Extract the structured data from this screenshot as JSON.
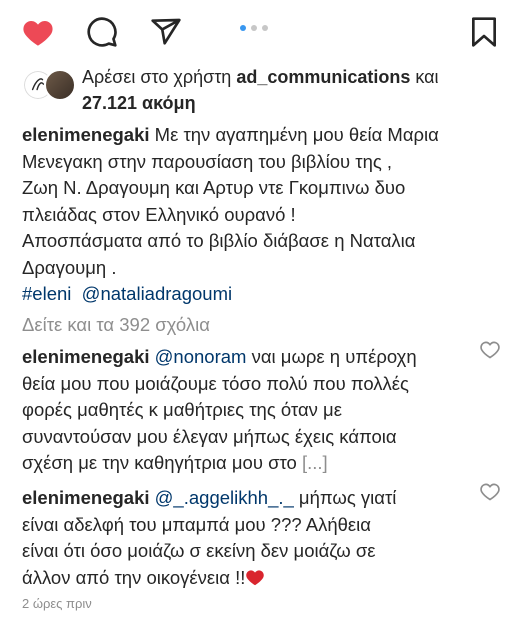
{
  "actions": {
    "like": "heart-filled-icon",
    "comment": "comment-icon",
    "share": "share-icon",
    "save": "bookmark-icon",
    "like_color": "#ed4956"
  },
  "carousel": {
    "count": 3,
    "active": 0
  },
  "likes": {
    "prefix": "Αρέσει στο χρήστη ",
    "user": "ad_communications",
    "middle": " και ",
    "count": "27.121 ακόμη"
  },
  "caption": {
    "username": "elenimenegaki",
    "line1": " Με την αγαπημένη μου θεία Μαρια",
    "line2": "Μενεγακη στην παρουσίαση του βιβλίου της ,",
    "line3": "Ζωη Ν. Δραγουμη και Αρτυρ ντε Γκομπινω  δυο",
    "line4": "πλειάδας στον Ελληνικό ουρανό !",
    "line5": "Αποσπάσματα από το βιβλίο διάβασε η Ναταλια",
    "line6": "Δραγουμη .",
    "hashtag": "#eleni",
    "mention": "@nataliadragoumi"
  },
  "view_comments": "Δείτε και τα 392 σχόλια",
  "comments": [
    {
      "username": "elenimenegaki",
      "mention": "@nonoram",
      "line1_rest": " ναι μωρε η υπέροχη",
      "line2": "θεία μου που μοιάζουμε τόσο πολύ που πολλές",
      "line3": "φορές μαθητές κ μαθήτριες της όταν με",
      "line4": "συναντούσαν μου έλεγαν μήπως έχεις κάποια",
      "line5": "σχέση με την καθηγήτρια μου στο ",
      "more": "[...]"
    },
    {
      "username": "elenimenegaki",
      "mention": "@_.aggelikhh_._",
      "line1_rest": " μήπως γιατί",
      "line2": "είναι αδελφή του μπαμπά μου ??? Αλήθεια",
      "line3": "είναι ότι όσο μοιάζω σ εκείνη δεν μοιάζω σε",
      "line4": "άλλον από την οικογένεια !!"
    }
  ],
  "timestamp": "2 ώρες πριν"
}
